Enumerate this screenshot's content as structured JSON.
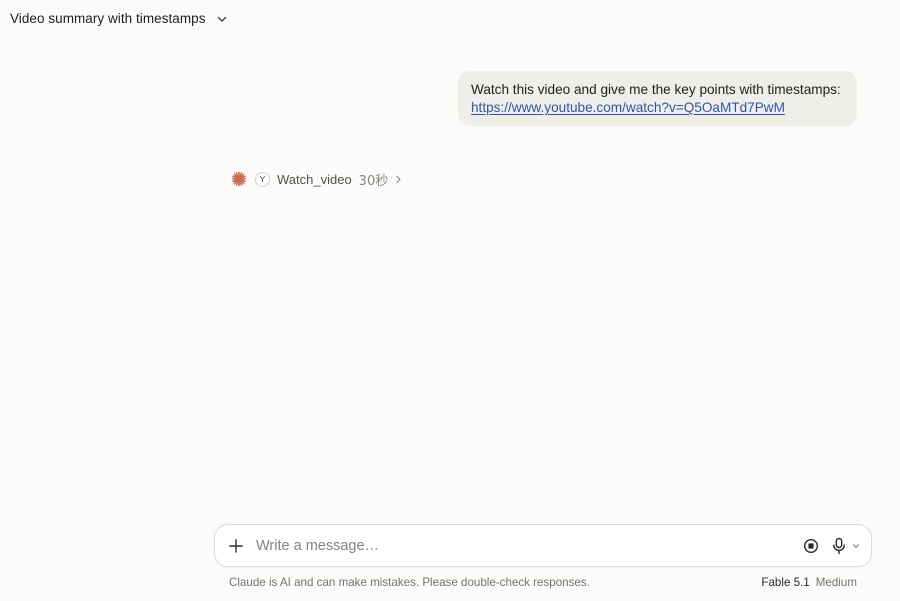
{
  "header": {
    "title": "Video summary with timestamps",
    "chevron_icon": "chevron-down-icon"
  },
  "user_message": {
    "text": "Watch this video and give me the key points with timestamps:",
    "link": "https://www.youtube.com/watch?v=Q5OaMTd7PwM"
  },
  "tool_call": {
    "status_icon": "spark-icon",
    "app_badge": "Y",
    "name": "Watch_video",
    "duration": "30秒",
    "expand_icon": "chevron-right-icon"
  },
  "composer": {
    "placeholder": "Write a message…",
    "value": "",
    "add_icon": "plus-icon",
    "stop_icon": "stop-icon",
    "mic_icon": "microphone-icon"
  },
  "footer": {
    "disclaimer": "Claude is AI and can make mistakes. Please double-check responses.",
    "model_name": "Fable 5.1",
    "model_effort": "Medium"
  },
  "colors": {
    "background": "#fbfbfa",
    "bubble": "#efeeea",
    "link": "#2a5aa6",
    "spark": "#c96a4f"
  }
}
